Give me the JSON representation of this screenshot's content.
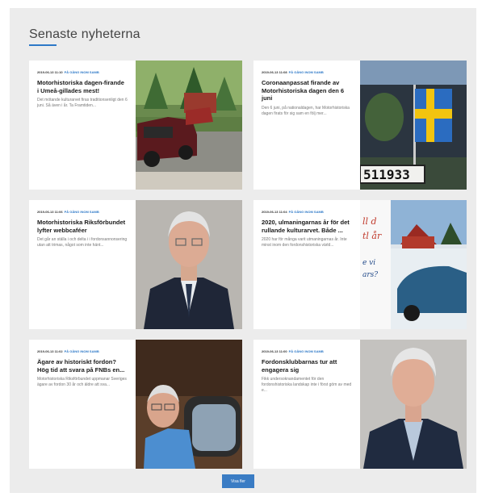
{
  "section": {
    "title": "Senaste nyheterna",
    "accent": "#2d78c7"
  },
  "posts": [
    {
      "meta": "2019-06-13 11:10",
      "category": "PÅ GÅNG INOM SAMB",
      "title": "Motorhistoriska dagen-firande i Umeå-gillades mest!",
      "excerpt": "Det mötande kulturarvet firas traditionsenligt den 6 juni. Så även i år. Ta Framtiden...",
      "image": "vintage-car-photo"
    },
    {
      "meta": "2019-06-13 11:08",
      "category": "PÅ GÅNG INOM SAMB",
      "title": "Coronaanpassat firande av Motorhistoriska dagen den 6 juni",
      "excerpt": "Den 6 juni, på nationaldagen, har Motorhistoriska dagen firats för sig sam en följ mer...",
      "image": "swedish-flag-car-photo"
    },
    {
      "meta": "2019-06-13 11:06",
      "category": "PÅ GÅNG INOM SAMB",
      "title": "Motorhistoriska Riksförbundet lyfter webbcaféer",
      "excerpt": "Det går an ställa i och delta i i fordonsannonsering utan att trimas, något som inte hänt...",
      "image": "portrait-photo"
    },
    {
      "meta": "2019-06-13 11:04",
      "category": "PÅ GÅNG INOM SAMB",
      "title": "2020, ulmaningarnas år för det rullande kulturarvet. Både ...",
      "excerpt": "2020 har för många varit utmaningarnas år. Inte minst inom den fordonshistoriska värld...",
      "image": "magazine-cover-photo"
    },
    {
      "meta": "2019-06-13 11:02",
      "category": "PÅ GÅNG INOM SAMB",
      "title": "Ägare av historiskt fordon? Hög tid att svara på FNBs en...",
      "excerpt": "Motorhistoriska Riksförbundet uppmanar Sveriges ägare av fordon 30 år och äldre att sva...",
      "image": "driver-photo"
    },
    {
      "meta": "2019-06-13 11:00",
      "category": "PÅ GÅNG INOM SAMB",
      "title": "Fordonsklubbarnas tur att engagera sig",
      "excerpt": "Fikk undersoknandamentet för den fordonshistoriska landskap inte i först göm av med e...",
      "image": "portrait-photo-2"
    }
  ],
  "load_more_label": "Visa fler"
}
